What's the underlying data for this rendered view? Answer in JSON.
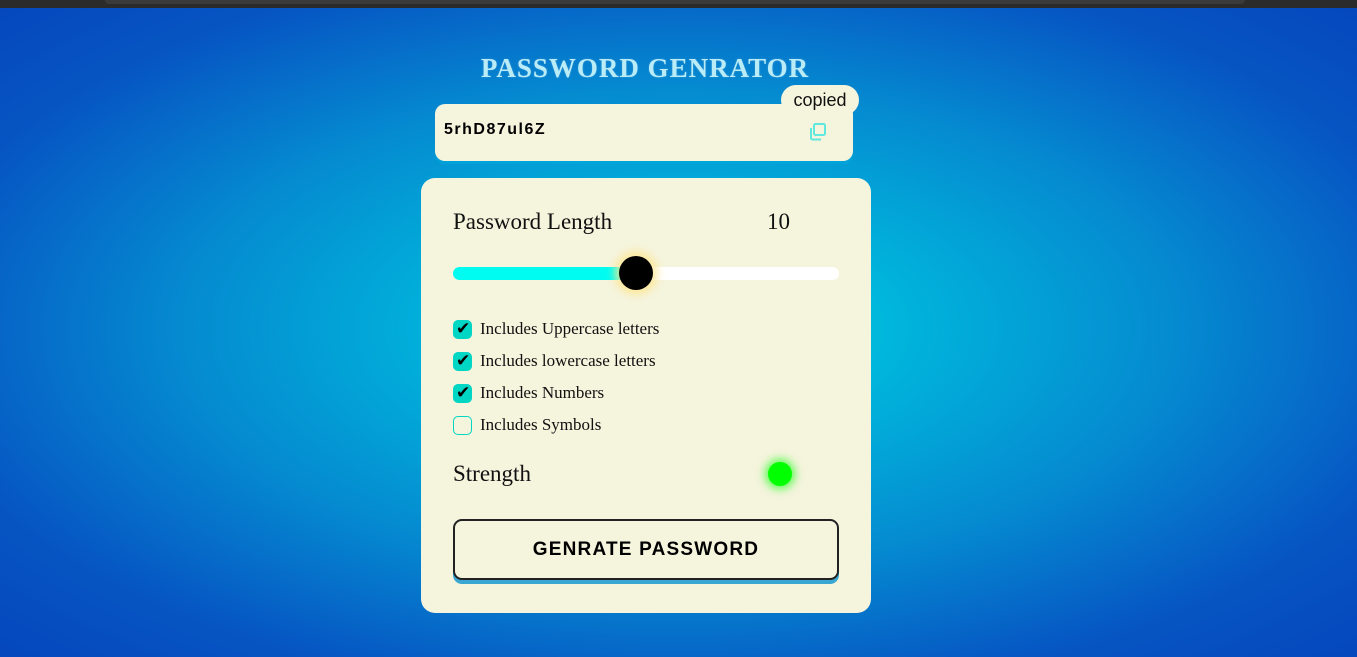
{
  "app": {
    "title": "PASSWORD GENRATOR"
  },
  "display": {
    "password": "5rhD87ul6Z",
    "copy_icon": "copy-icon",
    "tooltip": "copied"
  },
  "length": {
    "label": "Password Length",
    "value": "10",
    "slider_fraction": 0.474
  },
  "options": [
    {
      "label": "Includes Uppercase letters",
      "checked": true
    },
    {
      "label": "Includes lowercase letters",
      "checked": true
    },
    {
      "label": "Includes Numbers",
      "checked": true
    },
    {
      "label": "Includes Symbols",
      "checked": false
    }
  ],
  "strength": {
    "label": "Strength",
    "indicator_color": "#00ff00"
  },
  "generate_button": {
    "label": "GENRATE PASSWORD"
  },
  "colors": {
    "accent": "#00fcf0",
    "checkbox": "#00d6c4",
    "panel": "#f5f4dd",
    "title": "#b9ecf7"
  }
}
